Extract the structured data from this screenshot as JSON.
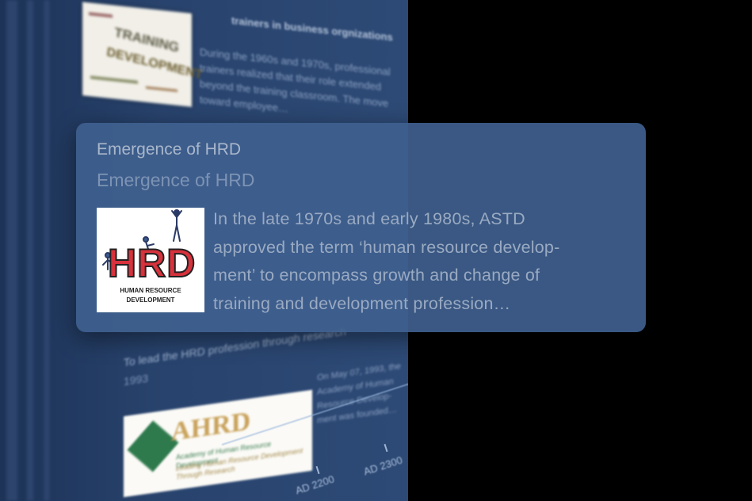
{
  "focused_card": {
    "title": "Emergence of HRD",
    "subtitle": "Emergence of HRD",
    "body_lines": [
      "In the late 1970s and early 1980s, ASTD",
      "approved the term ‘human resource develop-",
      "ment’ to encompass growth and change of",
      "training and development profession…"
    ],
    "image": {
      "icon": "hrd-logo",
      "letters": "HRD",
      "caption_line1": "HUMAN RESOURCE",
      "caption_line2": "DEVELOPMENT"
    }
  },
  "background_top_card": {
    "heading": "trainers in business orgnizations",
    "body_lines": [
      "During the 1960s and 1970s, professional",
      "trainers realized that their role extended",
      "beyond the training classroom. The move",
      "toward employee…"
    ],
    "image": {
      "icon": "training-development-wordcloud",
      "word1": "TRAINING",
      "word2": "DEVELOPMENT"
    }
  },
  "background_bottom_card": {
    "heading": "To lead the HRD profession through research",
    "year": "1993",
    "body_lines": [
      "On May 07, 1993, the",
      "Academy of Human",
      "Resource Develop-",
      "ment was founded…"
    ],
    "image": {
      "icon": "ahrd-logo",
      "letters": "AHRD",
      "sub1": "Academy of Human Resource Development",
      "sub2": "Leading Human Resource Development Through Research"
    }
  },
  "timeline_axis": {
    "ticks": [
      "AD 2200",
      "AD 2300"
    ]
  },
  "colors": {
    "background": "#000000",
    "panel": "#28436d",
    "card": "#3f608e",
    "title_text": "#a9b7cb",
    "subtitle_text": "#7d93b4",
    "body_text": "#9aaac2",
    "hrd_red": "#d8323c",
    "ahrd_green": "#2f7a4d",
    "ahrd_gold": "#c9a25b"
  }
}
